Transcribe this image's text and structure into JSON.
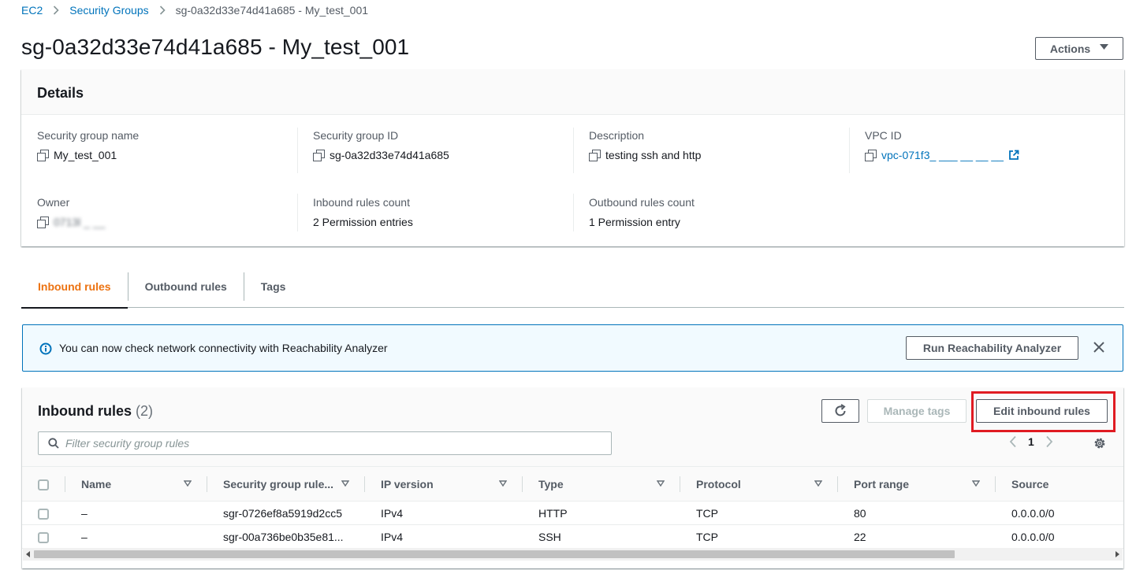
{
  "breadcrumb": {
    "root": "EC2",
    "section": "Security Groups",
    "current": "sg-0a32d33e74d41a685 - My_test_001"
  },
  "page_title": "sg-0a32d33e74d41a685 - My_test_001",
  "actions_label": "Actions",
  "details": {
    "heading": "Details",
    "sg_name": {
      "label": "Security group name",
      "value": "My_test_001"
    },
    "sg_id": {
      "label": "Security group ID",
      "value": "sg-0a32d33e74d41a685"
    },
    "description": {
      "label": "Description",
      "value": "testing ssh and http"
    },
    "vpc": {
      "label": "VPC ID",
      "value": "vpc-071f3_ ___ __ __ __"
    },
    "owner": {
      "label": "Owner",
      "value": "0713l _ __"
    },
    "inbound_count": {
      "label": "Inbound rules count",
      "value": "2 Permission entries"
    },
    "outbound_count": {
      "label": "Outbound rules count",
      "value": "1 Permission entry"
    }
  },
  "tabs": [
    "Inbound rules",
    "Outbound rules",
    "Tags"
  ],
  "banner": {
    "text": "You can now check network connectivity with Reachability Analyzer",
    "button": "Run Reachability Analyzer"
  },
  "rules": {
    "title": "Inbound rules",
    "count": "(2)",
    "manage_tags": "Manage tags",
    "edit": "Edit inbound rules",
    "filter_placeholder": "Filter security group rules",
    "page": "1",
    "columns": [
      "Name",
      "Security group rule...",
      "IP version",
      "Type",
      "Protocol",
      "Port range",
      "Source"
    ],
    "rows": [
      {
        "name": "–",
        "rule_id": "sgr-0726ef8a5919d2cc5",
        "ip_version": "IPv4",
        "type": "HTTP",
        "protocol": "TCP",
        "port": "80",
        "source": "0.0.0.0/0"
      },
      {
        "name": "–",
        "rule_id": "sgr-00a736be0b35e81...",
        "ip_version": "IPv4",
        "type": "SSH",
        "protocol": "TCP",
        "port": "22",
        "source": "0.0.0.0/0"
      }
    ]
  },
  "colors": {
    "link": "#0073bb",
    "active_tab": "#ec7211",
    "highlight": "#e01b22",
    "banner_bg": "#f1faff"
  }
}
